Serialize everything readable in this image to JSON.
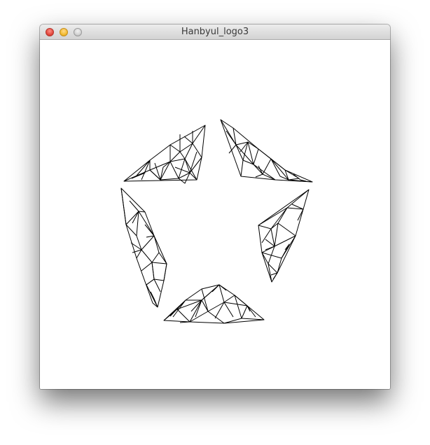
{
  "window": {
    "title": "Hanbyul_logo3",
    "controls": {
      "close": "close-icon",
      "minimize": "minimize-icon",
      "zoom": "zoom-icon"
    }
  },
  "logo": {
    "shape": "five-segment star outline rendered as black triangle wireframe",
    "stroke_color": "#000000",
    "background": "#ffffff"
  }
}
